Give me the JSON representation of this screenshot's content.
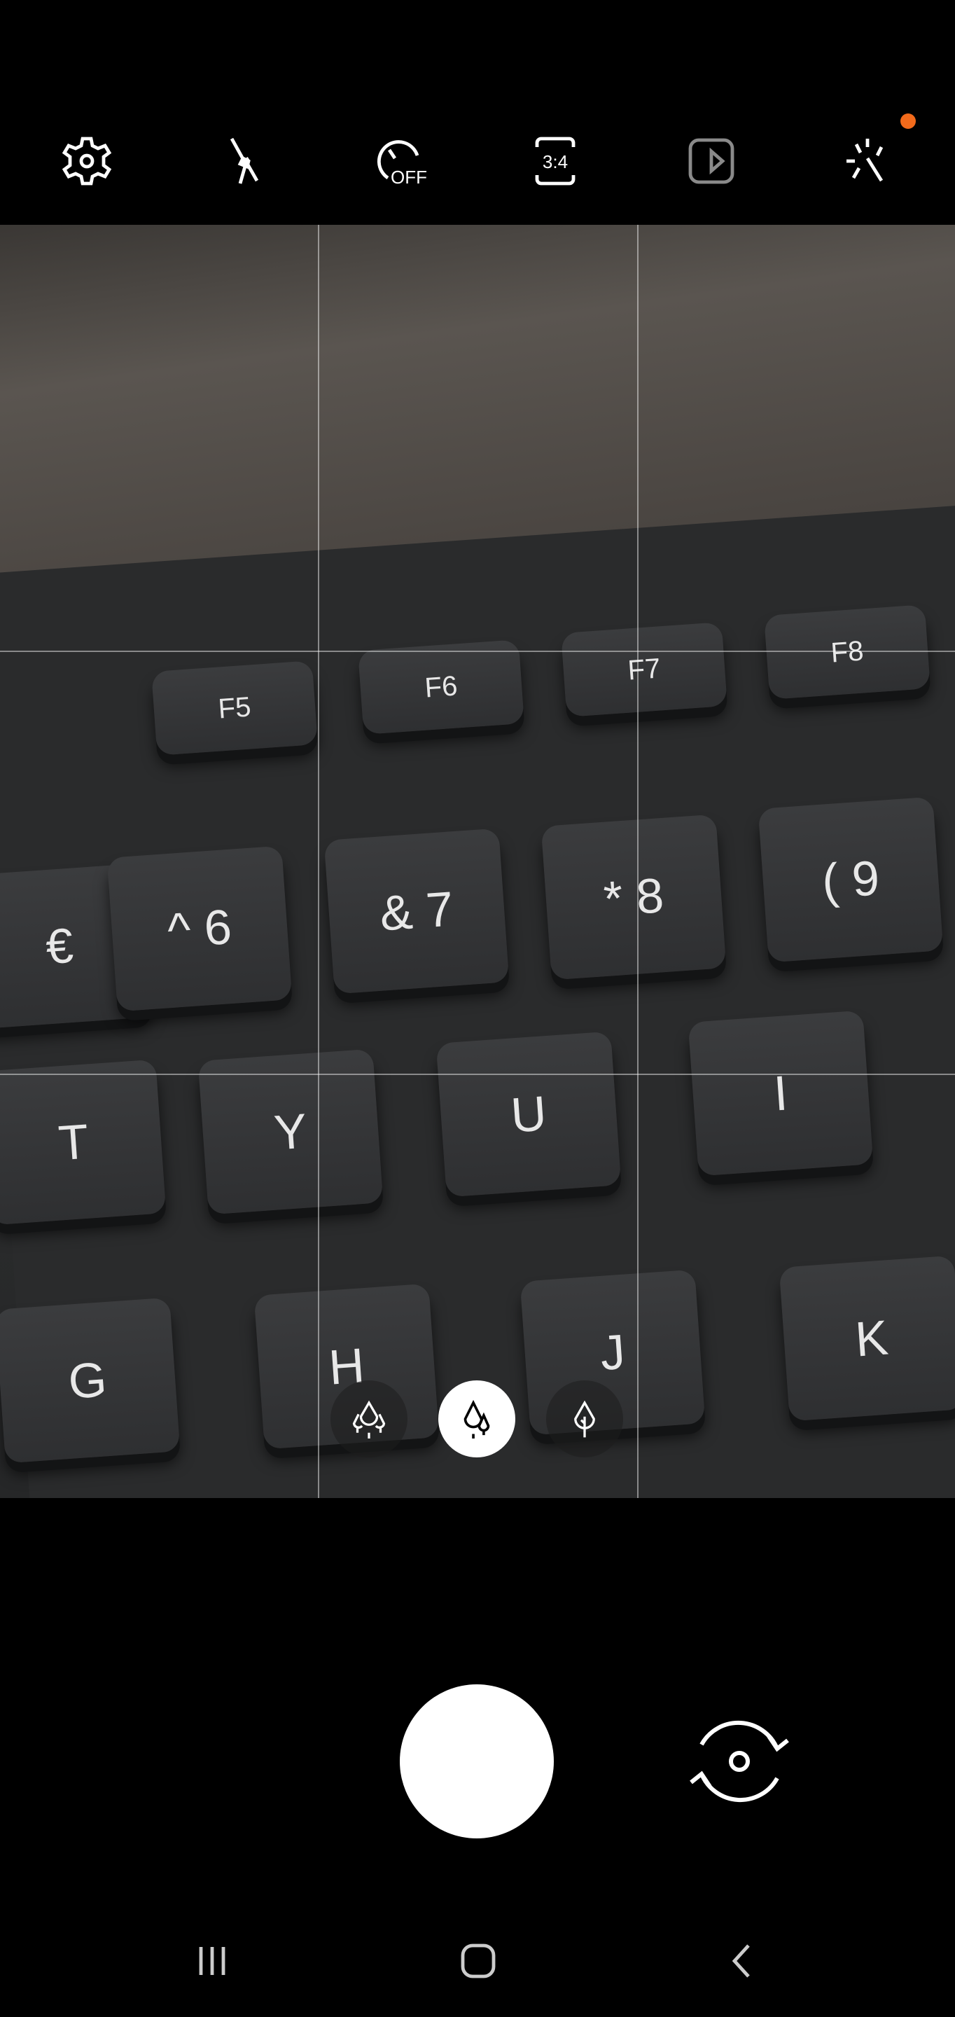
{
  "toolbar": {
    "items": [
      {
        "icon": "gear-icon",
        "label": "Settings"
      },
      {
        "icon": "flash-off-icon",
        "label": "Flash off"
      },
      {
        "icon": "timer-off-icon",
        "label": "OFF"
      },
      {
        "icon": "aspect-ratio-icon",
        "label": "3:4"
      },
      {
        "icon": "motion-photo-icon",
        "label": "Motion photo"
      },
      {
        "icon": "filters-icon",
        "label": "Effects"
      }
    ],
    "notification_color": "#f26a1b"
  },
  "viewfinder": {
    "keys": [
      "F5",
      "F6",
      "F7",
      "F8",
      "€",
      "^ 6",
      "& 7",
      "* 8",
      "( 9",
      "T",
      "Y",
      "U",
      "I",
      "G",
      "H",
      "J",
      "K"
    ]
  },
  "zoom": {
    "options": [
      {
        "icon": "ultra-wide-trees-icon",
        "selected": false
      },
      {
        "icon": "wide-trees-icon",
        "selected": true
      },
      {
        "icon": "tele-tree-icon",
        "selected": false
      }
    ]
  },
  "controls": {
    "shutter": "shutter-button",
    "switch": "switch-camera-icon"
  },
  "navbar": {
    "items": [
      "recent-apps-icon",
      "home-icon",
      "back-icon"
    ]
  }
}
